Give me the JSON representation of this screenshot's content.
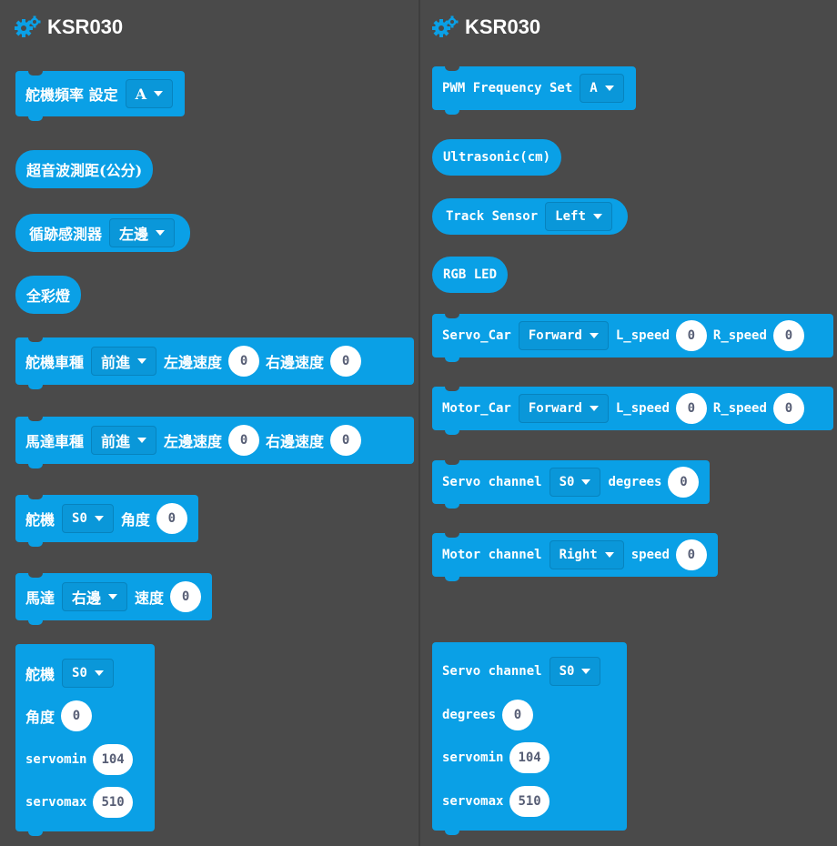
{
  "left": {
    "title": "KSR030",
    "pwm": {
      "label": "舵機頻率 設定",
      "value": "A"
    },
    "ultrasonic": {
      "label": "超音波測距(公分)"
    },
    "track": {
      "label": "循跡感測器",
      "value": "左邊"
    },
    "rgb": {
      "label": "全彩燈"
    },
    "servo_car": {
      "label": "舵機車種",
      "dir": "前進",
      "l_label": "左邊速度",
      "l_val": "0",
      "r_label": "右邊速度",
      "r_val": "0"
    },
    "motor_car": {
      "label": "馬達車種",
      "dir": "前進",
      "l_label": "左邊速度",
      "l_val": "0",
      "r_label": "右邊速度",
      "r_val": "0"
    },
    "servo": {
      "label": "舵機",
      "channel": "S0",
      "angle_label": "角度",
      "angle_val": "0"
    },
    "motor": {
      "label": "馬達",
      "side": "右邊",
      "speed_label": "速度",
      "speed_val": "0"
    },
    "servo_adv": {
      "label": "舵機",
      "channel": "S0",
      "angle_label": "角度",
      "angle_val": "0",
      "min_label": "servomin",
      "min_val": "104",
      "max_label": "servomax",
      "max_val": "510"
    }
  },
  "right": {
    "title": "KSR030",
    "pwm": {
      "label": "PWM Frequency Set",
      "value": "A"
    },
    "ultrasonic": {
      "label": "Ultrasonic(cm)"
    },
    "track": {
      "label": "Track Sensor",
      "value": "Left"
    },
    "rgb": {
      "label": "RGB LED"
    },
    "servo_car": {
      "label": "Servo_Car",
      "dir": "Forward",
      "l_label": "L_speed",
      "l_val": "0",
      "r_label": "R_speed",
      "r_val": "0"
    },
    "motor_car": {
      "label": "Motor_Car",
      "dir": "Forward",
      "l_label": "L_speed",
      "l_val": "0",
      "r_label": "R_speed",
      "r_val": "0"
    },
    "servo": {
      "label": "Servo channel",
      "channel": "S0",
      "angle_label": "degrees",
      "angle_val": "0"
    },
    "motor": {
      "label": "Motor channel",
      "side": "Right",
      "speed_label": "speed",
      "speed_val": "0"
    },
    "servo_adv": {
      "label": "Servo channel",
      "channel": "S0",
      "angle_label": "degrees",
      "angle_val": "0",
      "min_label": "servomin",
      "min_val": "104",
      "max_label": "servomax",
      "max_val": "510"
    }
  },
  "colors": {
    "background": "#4a4a4a",
    "block": "#0aa0e6",
    "dropdown": "#0a97d9",
    "gear": "#0aa0e6"
  },
  "icons": {
    "header": "gears-icon",
    "dropdown": "caret-down-icon"
  }
}
